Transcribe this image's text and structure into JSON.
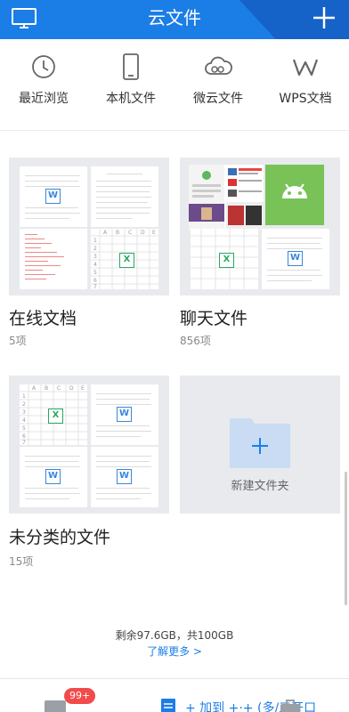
{
  "header": {
    "title": "云文件"
  },
  "quick": [
    {
      "label": "最近浏览",
      "icon": "clock-icon"
    },
    {
      "label": "本机文件",
      "icon": "phone-icon"
    },
    {
      "label": "微云文件",
      "icon": "cloud-icon"
    },
    {
      "label": "WPS文档",
      "icon": "wps-logo-icon"
    }
  ],
  "folders": [
    {
      "name": "在线文档",
      "count": "5项"
    },
    {
      "name": "聊天文件",
      "count": "856项"
    },
    {
      "name": "未分类的文件",
      "count": "15项"
    }
  ],
  "new_folder": {
    "label": "新建文件夹"
  },
  "storage": {
    "text": "剩余97.6GB，共100GB",
    "more": "了解更多 >"
  },
  "bottom": {
    "badge": "99+",
    "partial_text": "+ 加到 +·+ (多/三开口"
  },
  "badges": {
    "word": "W",
    "excel": "X"
  },
  "grid_headers": {
    "a": "A",
    "b": "B",
    "c": "C",
    "d": "D",
    "e": "E"
  },
  "grid_rows": [
    "1",
    "2",
    "3",
    "4",
    "5",
    "6",
    "7"
  ],
  "colors": {
    "brand": "#1b7de6",
    "header_dark": "#1562c9",
    "badge_red": "#f24b4b",
    "excel_green": "#2aa865",
    "android_green": "#78c257"
  }
}
